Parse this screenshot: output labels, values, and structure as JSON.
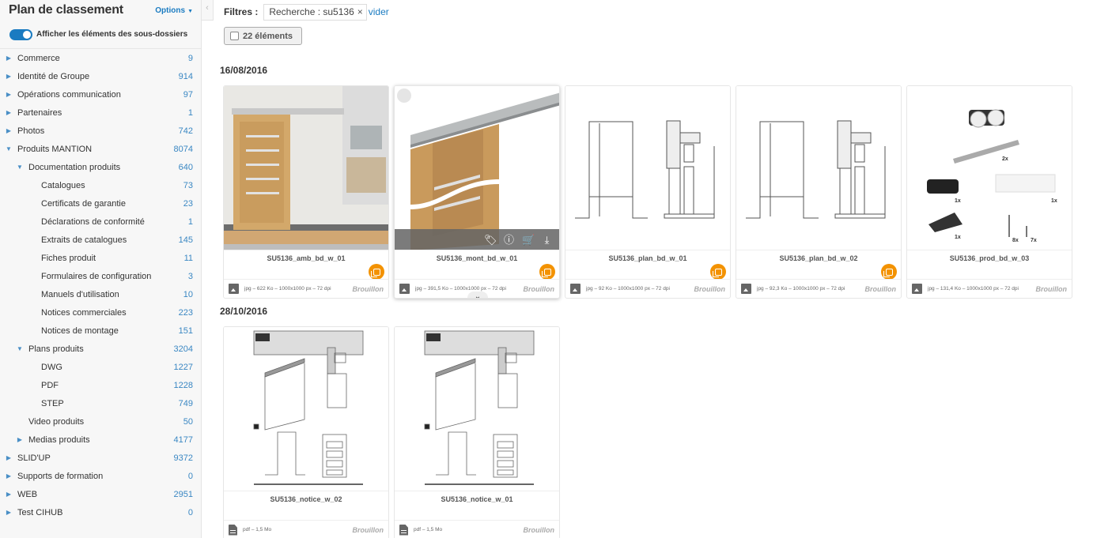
{
  "sidebar": {
    "title": "Plan de classement",
    "options_label": "Options",
    "toggle_label": "Afficher les éléments des sous-dossiers",
    "toggle_on": true,
    "tree": [
      {
        "label": "Commerce",
        "count": "9",
        "level": 0,
        "state": "collapsed"
      },
      {
        "label": "Identité de Groupe",
        "count": "914",
        "level": 0,
        "state": "collapsed"
      },
      {
        "label": "Opérations communication",
        "count": "97",
        "level": 0,
        "state": "collapsed"
      },
      {
        "label": "Partenaires",
        "count": "1",
        "level": 0,
        "state": "collapsed"
      },
      {
        "label": "Photos",
        "count": "742",
        "level": 0,
        "state": "collapsed"
      },
      {
        "label": "Produits MANTION",
        "count": "8074",
        "level": 0,
        "state": "expanded"
      },
      {
        "label": "Documentation produits",
        "count": "640",
        "level": 1,
        "state": "expanded"
      },
      {
        "label": "Catalogues",
        "count": "73",
        "level": 2,
        "state": "leaf"
      },
      {
        "label": "Certificats de garantie",
        "count": "23",
        "level": 2,
        "state": "leaf"
      },
      {
        "label": "Déclarations de conformité",
        "count": "1",
        "level": 2,
        "state": "leaf"
      },
      {
        "label": "Extraits de catalogues",
        "count": "145",
        "level": 2,
        "state": "leaf"
      },
      {
        "label": "Fiches produit",
        "count": "11",
        "level": 2,
        "state": "leaf"
      },
      {
        "label": "Formulaires de configuration",
        "count": "3",
        "level": 2,
        "state": "leaf"
      },
      {
        "label": "Manuels d'utilisation",
        "count": "10",
        "level": 2,
        "state": "leaf"
      },
      {
        "label": "Notices commerciales",
        "count": "223",
        "level": 2,
        "state": "leaf"
      },
      {
        "label": "Notices de montage",
        "count": "151",
        "level": 2,
        "state": "leaf"
      },
      {
        "label": "Plans produits",
        "count": "3204",
        "level": 1,
        "state": "expanded"
      },
      {
        "label": "DWG",
        "count": "1227",
        "level": 2,
        "state": "leaf"
      },
      {
        "label": "PDF",
        "count": "1228",
        "level": 2,
        "state": "leaf"
      },
      {
        "label": "STEP",
        "count": "749",
        "level": 2,
        "state": "leaf"
      },
      {
        "label": "Video produits",
        "count": "50",
        "level": 1,
        "state": "leaf"
      },
      {
        "label": "Medias produits",
        "count": "4177",
        "level": 1,
        "state": "collapsed"
      },
      {
        "label": "SLID'UP",
        "count": "9372",
        "level": 0,
        "state": "collapsed"
      },
      {
        "label": "Supports de formation",
        "count": "0",
        "level": 0,
        "state": "collapsed"
      },
      {
        "label": "WEB",
        "count": "2951",
        "level": 0,
        "state": "collapsed"
      },
      {
        "label": "Test CIHUB",
        "count": "0",
        "level": 0,
        "state": "collapsed"
      }
    ]
  },
  "filters": {
    "label": "Filtres :",
    "chip": "Recherche : su5136",
    "chip_close": "×",
    "clear": "vider"
  },
  "selection": {
    "count_label": "22 éléments"
  },
  "groups": [
    {
      "date": "16/08/2016",
      "items": [
        {
          "name": "SU5136_amb_bd_w_01",
          "meta": "jpg – 622 Ko – 1000x1000 px – 72 dpi",
          "status": "Brouillon",
          "type": "image",
          "thumb": "door-photo",
          "has_orange": true
        },
        {
          "name": "SU5136_mont_bd_w_01",
          "meta": "jpg – 391,5 Ko – 1000x1000 px – 72 dpi",
          "status": "Brouillon",
          "type": "image",
          "thumb": "door-render",
          "has_orange": true,
          "hovered": true
        },
        {
          "name": "SU5136_plan_bd_w_01",
          "meta": "jpg – 92 Ko – 1000x1000 px – 72 dpi",
          "status": "Brouillon",
          "type": "image",
          "thumb": "plan",
          "has_orange": true
        },
        {
          "name": "SU5136_plan_bd_w_02",
          "meta": "jpg – 92,3 Ko – 1000x1000 px – 72 dpi",
          "status": "Brouillon",
          "type": "image",
          "thumb": "plan",
          "has_orange": true
        },
        {
          "name": "SU5136_prod_bd_w_03",
          "meta": "jpg – 131,4 Ko – 1000x1000 px – 72 dpi",
          "status": "Brouillon",
          "type": "image",
          "thumb": "parts",
          "has_orange": false
        }
      ]
    },
    {
      "date": "28/10/2016",
      "items": [
        {
          "name": "SU5136_notice_w_02",
          "meta": "pdf – 1,5 Mo",
          "status": "Brouillon",
          "type": "pdf",
          "thumb": "notice",
          "has_orange": false
        },
        {
          "name": "SU5136_notice_w_01",
          "meta": "pdf – 1,5 Mo",
          "status": "Brouillon",
          "type": "pdf",
          "thumb": "notice",
          "has_orange": false
        }
      ]
    }
  ],
  "hover_actions": [
    {
      "icon": "tag-icon",
      "glyph": "🏷"
    },
    {
      "icon": "info-icon",
      "glyph": "ⓘ"
    },
    {
      "icon": "cart-add-icon",
      "glyph": "🛒"
    },
    {
      "icon": "download-icon",
      "glyph": "⤓"
    }
  ],
  "colors": {
    "accent": "#1a7bc1",
    "orange": "#f39200",
    "count": "#3a87c3"
  }
}
